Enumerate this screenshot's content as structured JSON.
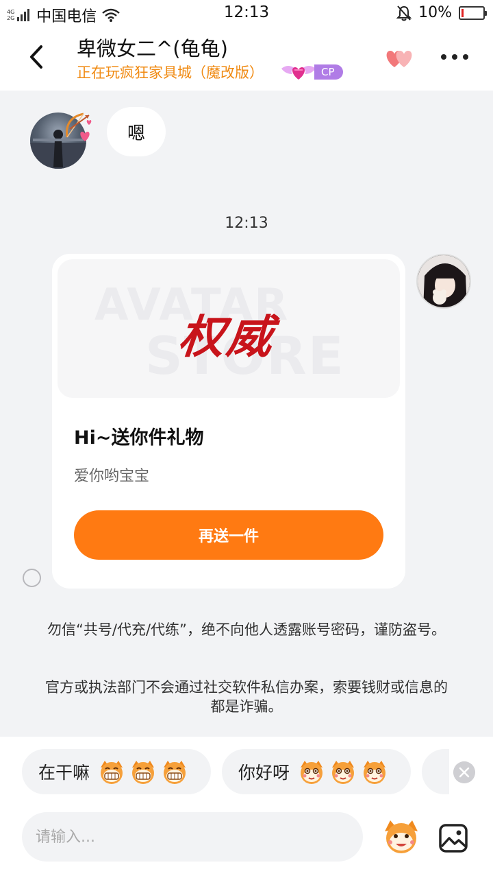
{
  "status_bar": {
    "network_top": "4G",
    "network_bottom": "2G",
    "carrier": "中国电信",
    "time": "12:13",
    "battery_percent": "10%",
    "battery_level": 0.1,
    "battery_color": "#e02020",
    "icons": [
      "signal-icon",
      "wifi-icon",
      "mute-bell-icon",
      "battery-icon"
    ]
  },
  "header": {
    "title": "卑微女二^(龟龟)",
    "subtitle": "正在玩疯狂家具城（魔改版）",
    "cp_badge": "CP",
    "icons": [
      "back-arrow-icon",
      "winged-heart-icon",
      "double-heart-icon",
      "more-dots-icon"
    ]
  },
  "chat": {
    "messages": [
      {
        "sender": "left",
        "text": "嗯"
      }
    ],
    "timestamp": "12:13",
    "gift_card": {
      "watermark_line1": "AVATAR",
      "watermark_line2": "STORE",
      "gift_name": "权威",
      "title": "Hi~送你件礼物",
      "description": "爱你哟宝宝",
      "button_label": "再送一件"
    },
    "notice_1": "勿信“共号/代充/代练”，绝不向他人透露账号密码，谨防盗号。",
    "notice_2": "官方或执法部门不会通过社交软件私信办案，索要钱财或信息的都是诈骗。"
  },
  "quick_replies": [
    {
      "text": "在干嘛",
      "emoji": "grinning-face-emoji"
    },
    {
      "text": "你好呀",
      "emoji": "smiling-face-emoji"
    }
  ],
  "input": {
    "placeholder": "请输入..."
  },
  "colors": {
    "accent": "#ff7a12",
    "subtitle": "#f08a12",
    "cp": "#b07ce6",
    "gift_red": "#c8141b"
  }
}
